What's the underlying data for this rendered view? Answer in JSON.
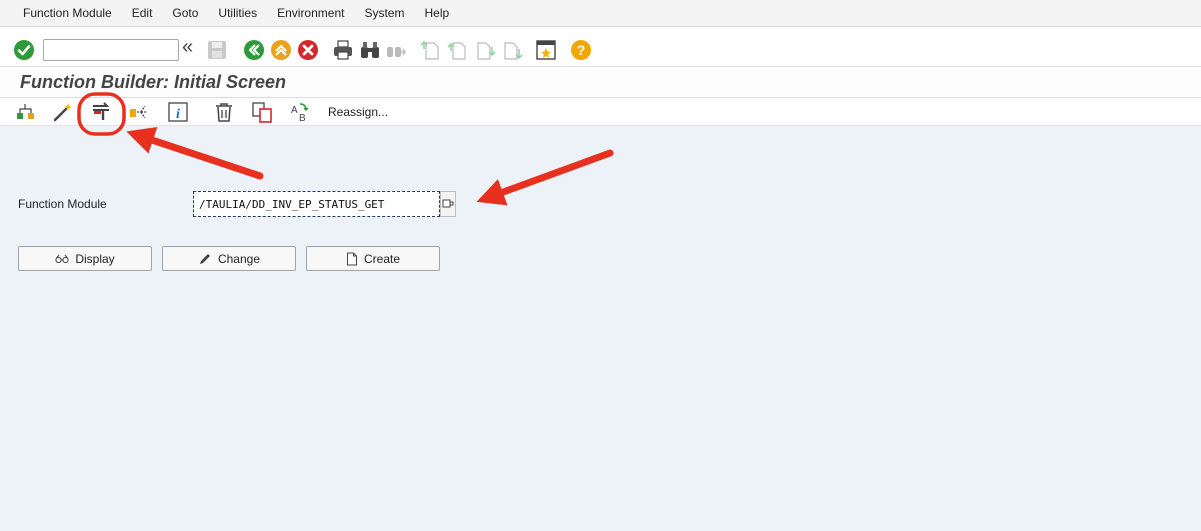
{
  "menu": [
    "Function Module",
    "Edit",
    "Goto",
    "Utilities",
    "Environment",
    "System",
    "Help"
  ],
  "standard_toolbar": {
    "command_field": {
      "value": "",
      "placeholder": ""
    },
    "collapse_glyph": "«",
    "icons": [
      "enter-icon",
      "save-icon",
      "back-icon",
      "exit-icon",
      "cancel-icon",
      "print-icon",
      "find-icon",
      "find-next-icon",
      "first-page-icon",
      "previous-page-icon",
      "next-page-icon",
      "last-page-icon",
      "layout-icon",
      "help-icon"
    ]
  },
  "title": "Function Builder: Initial Screen",
  "app_toolbar": {
    "icons": [
      "other-object-icon",
      "wizard-icon",
      "where-used-icon",
      "test-icon",
      "info-icon",
      "delete-icon",
      "copy-icon",
      "rename-icon"
    ],
    "reassign_label": "Reassign..."
  },
  "form": {
    "function_module_label": "Function Module",
    "function_module_value": "/TAULIA/DD_INV_EP_STATUS_GET"
  },
  "buttons": {
    "display": "Display",
    "change": "Change",
    "create": "Create"
  },
  "annotation_color": "#e8301f"
}
